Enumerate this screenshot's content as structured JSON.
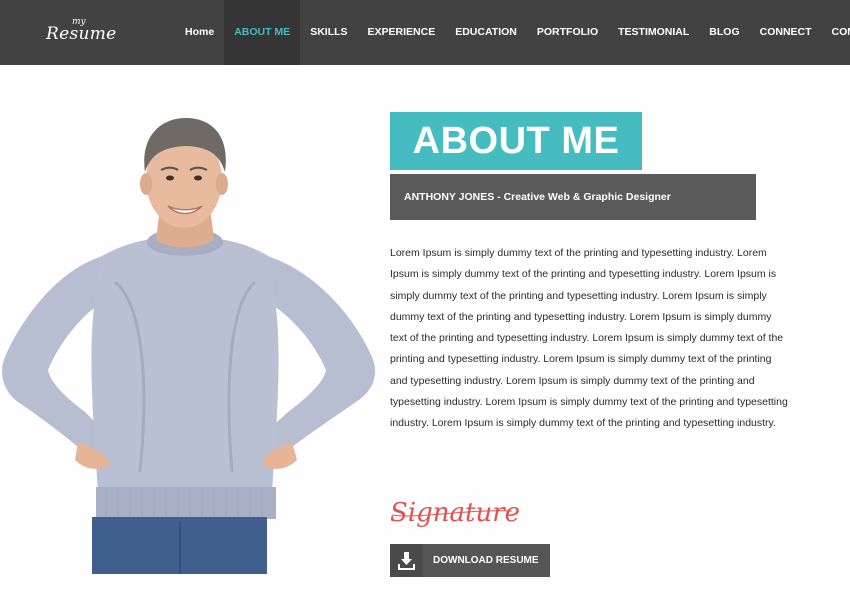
{
  "logo": {
    "small": "my",
    "big": "Resume"
  },
  "nav": {
    "items": [
      "Home",
      "ABOUT ME",
      "SKILLS",
      "EXPERIENCE",
      "EDUCATION",
      "PORTFOLIO",
      "TESTIMONIAL",
      "BLOG",
      "CONNECT",
      "CONTACT"
    ],
    "active_index": 1
  },
  "about": {
    "heading": "ABOUT ME",
    "subtitle": "ANTHONY JONES - Creative Web & Graphic Designer",
    "body": "Lorem Ipsum is simply dummy text of the printing and typesetting industry. Lorem Ipsum is simply dummy text of the printing and typesetting industry. Lorem Ipsum is simply dummy text of the printing and typesetting industry. Lorem Ipsum is simply dummy text of the printing and typesetting industry. Lorem Ipsum is simply dummy text of the printing and typesetting industry. Lorem Ipsum is simply dummy text of the printing and typesetting industry. Lorem Ipsum is simply dummy text of the printing and typesetting industry. Lorem Ipsum is simply dummy text of the printing and typesetting industry. Lorem Ipsum is simply dummy text of the printing and typesetting industry. Lorem Ipsum is simply dummy text of the printing and typesetting industry.",
    "signature": "Signature"
  },
  "download": {
    "label": "DOWNLOAD RESUME",
    "icon": "download-icon"
  },
  "colors": {
    "accent": "#45bcc0",
    "header_bg": "#424242",
    "active_nav_bg": "#353535",
    "subtitle_bg": "#5a5a5a",
    "signature": "#e05252",
    "button_bg": "#555555"
  }
}
